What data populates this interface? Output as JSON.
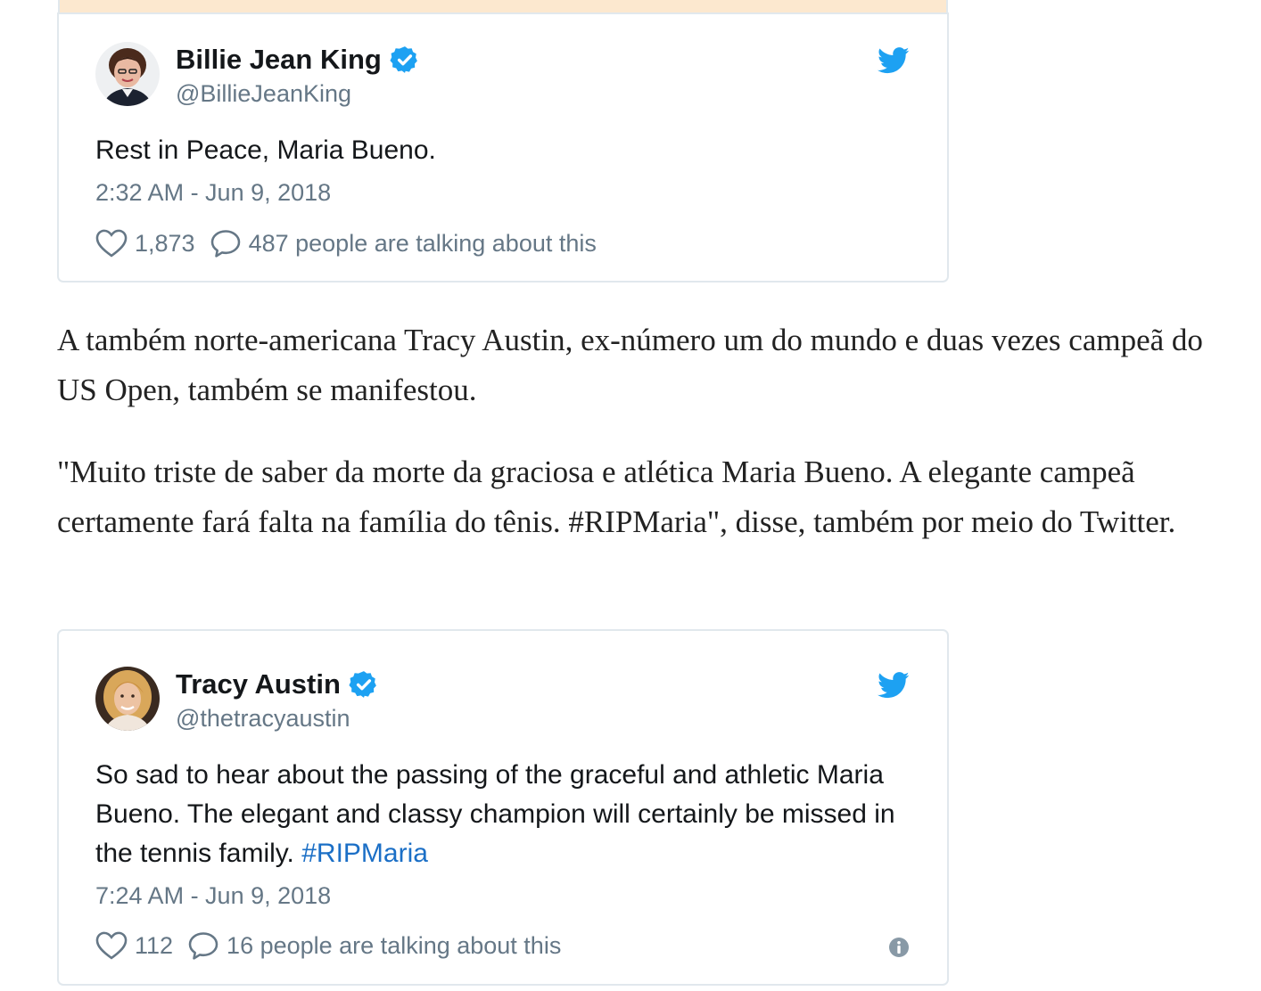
{
  "tweets": [
    {
      "author_name": "Billie Jean King",
      "handle": "@BillieJeanKing",
      "text": "Rest in Peace, Maria Bueno.",
      "timestamp": "2:32 AM - Jun 9, 2018",
      "likes": "1,873",
      "talking": "487 people are talking about this",
      "avatar_icon": "avatar-photo-icon",
      "verified_icon": "verified-badge-icon",
      "brand_icon": "twitter-bird-icon"
    },
    {
      "author_name": "Tracy Austin",
      "handle": "@thetracyaustin",
      "text": "So sad to hear about the passing of the graceful and athletic Maria Bueno. The elegant and classy champion will certainly be missed in the tennis family.",
      "hashtag": "#RIPMaria",
      "timestamp": "7:24 AM - Jun 9, 2018",
      "likes": "112",
      "talking": "16 people are talking about this",
      "avatar_icon": "avatar-photo-icon",
      "verified_icon": "verified-badge-icon",
      "brand_icon": "twitter-bird-icon",
      "info_icon": "info-icon"
    }
  ],
  "article": {
    "paragraph_1": "A também norte-americana Tracy Austin, ex-número um do mundo e duas vezes campeã do US Open, também se manifestou.",
    "paragraph_2": "\"Muito triste de saber da morte da graciosa e atlética Maria Bueno. A elegante campeã certamente fará falta na família do tênis. #RIPMaria\", disse, também por meio do Twitter."
  },
  "colors": {
    "twitter_blue": "#1da1f2",
    "hashtag_link": "#1b6fc6",
    "secondary_text": "#657786",
    "card_border": "#e1e8ed",
    "top_strip": "#fce8cf"
  }
}
